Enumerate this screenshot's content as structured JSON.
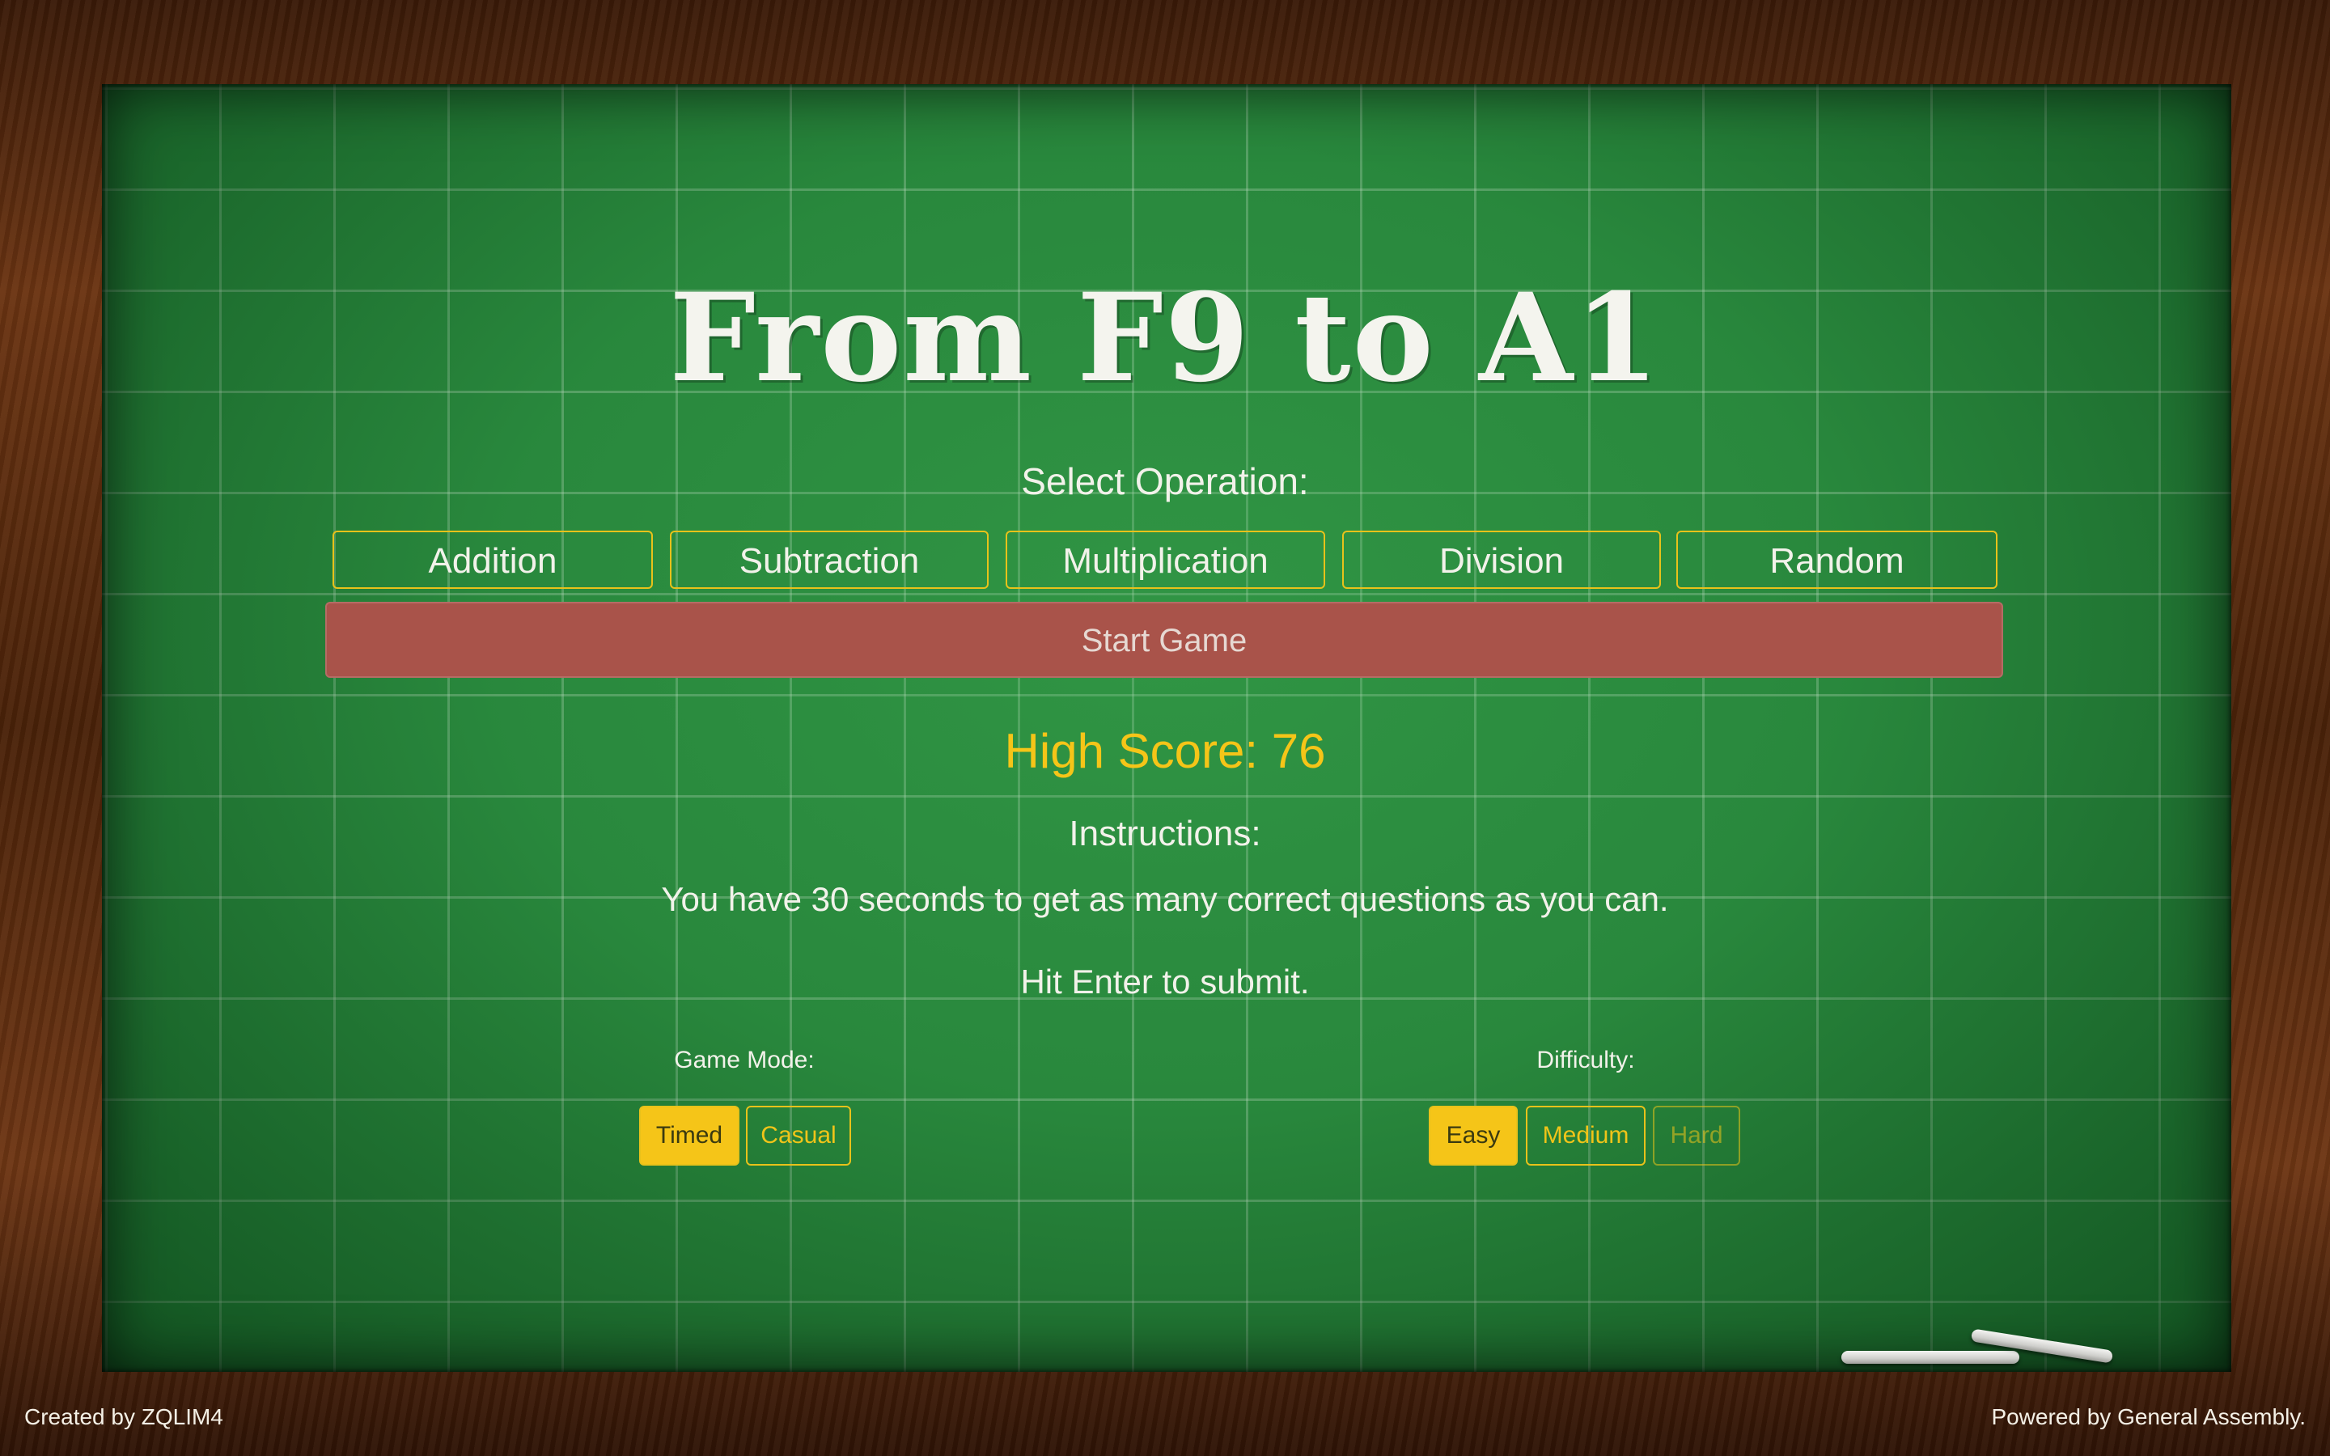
{
  "game": {
    "title": "From F9 to A1",
    "select_label": "Select Operation:",
    "operations": [
      {
        "label": "Addition"
      },
      {
        "label": "Subtraction"
      },
      {
        "label": "Multiplication"
      },
      {
        "label": "Division"
      },
      {
        "label": "Random"
      }
    ],
    "start_label": "Start Game",
    "high_score": "High Score: 76",
    "instructions_title": "Instructions:",
    "instructions": [
      "You have 30 seconds to get as many correct questions as you can.",
      "Hit Enter to submit."
    ],
    "game_mode": {
      "label": "Game Mode:",
      "options": [
        "Timed",
        "Casual"
      ],
      "selected": "Timed"
    },
    "difficulty": {
      "label": "Difficulty:",
      "options": [
        "Easy",
        "Medium",
        "Hard"
      ],
      "selected": "Easy"
    }
  },
  "footer": {
    "left": "Created by ZQLIM4",
    "right": "Powered by General Assembly."
  },
  "colors": {
    "board": "#2a8a3e",
    "frame": "#5a2a0c",
    "accent": "#f5c518",
    "start_button": "#a9534a"
  }
}
